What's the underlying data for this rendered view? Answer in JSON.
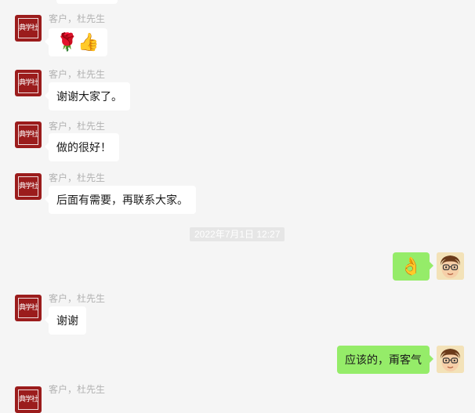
{
  "chat": {
    "sender_name": "客户，杜先生",
    "logo_text": "典学社",
    "timestamp": "2022年7月1日 12:27",
    "messages": [
      {
        "from": "other",
        "text": "🌹👍"
      },
      {
        "from": "other",
        "text": "谢谢大家了。"
      },
      {
        "from": "other",
        "text": "做的很好！"
      },
      {
        "from": "other",
        "text": "后面有需要，再联系大家。"
      },
      {
        "from": "me",
        "text": "👌"
      },
      {
        "from": "other",
        "text": "谢谢"
      },
      {
        "from": "me",
        "text": "应该的，甭客气"
      }
    ]
  },
  "icons": {
    "other_avatar": "school-logo-avatar",
    "my_avatar": "cartoon-face-avatar"
  },
  "colors": {
    "background": "#f5f5f5",
    "incoming_bubble": "#ffffff",
    "outgoing_bubble": "#95ec69",
    "logo_red": "#9b1c1c",
    "meta_text": "#b2b2b2"
  }
}
